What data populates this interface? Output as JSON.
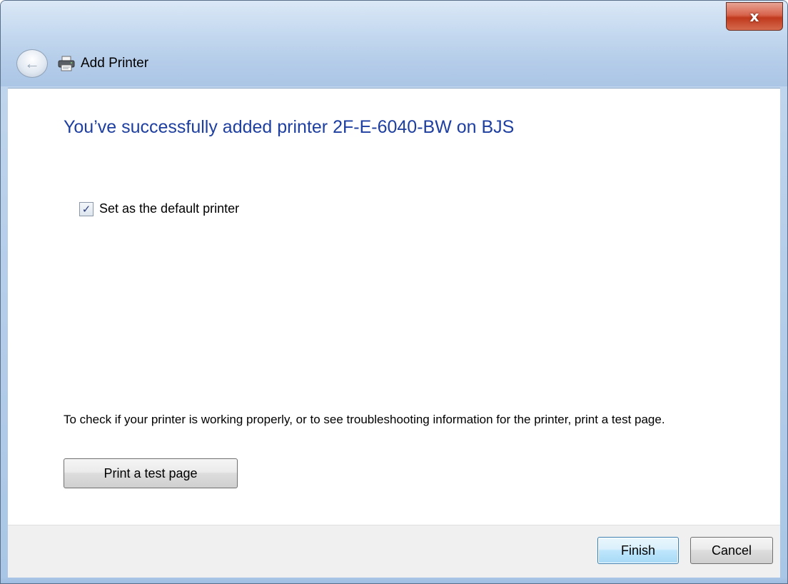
{
  "window": {
    "title": "Add Printer",
    "close_glyph": "x",
    "back_glyph": "←"
  },
  "content": {
    "heading": "You’ve successfully added printer 2F-E-6040-BW on BJS",
    "default_printer": {
      "label": "Set as the default printer",
      "checked": true,
      "check_glyph": "✓"
    },
    "info_text": "To check if your printer is working properly, or to see troubleshooting information for the printer, print a test page.",
    "test_page_button": "Print a test page"
  },
  "footer": {
    "finish_label": "Finish",
    "cancel_label": "Cancel"
  },
  "colors": {
    "heading": "#1e3fa0",
    "close_button": "#c0391d",
    "frame": "#b5cde9"
  },
  "icons": {
    "back": "back-arrow-icon",
    "printer": "printer-icon",
    "close": "close-icon",
    "check": "checkmark-icon"
  }
}
